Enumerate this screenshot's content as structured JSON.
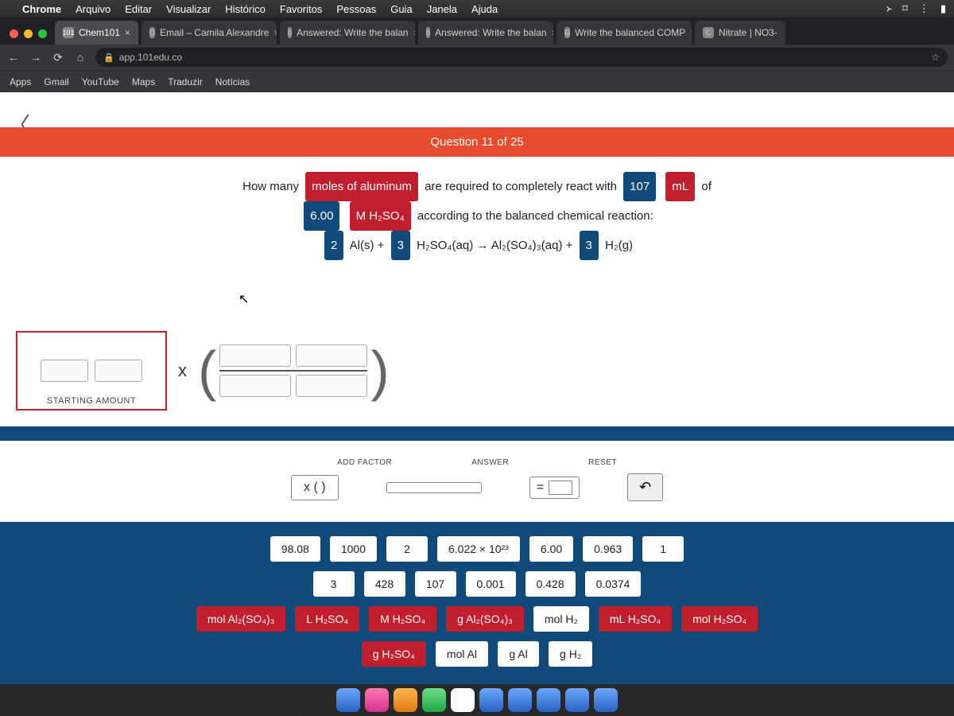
{
  "mac_menu": {
    "app": "Chrome",
    "items": [
      "Arquivo",
      "Editar",
      "Visualizar",
      "Histórico",
      "Favoritos",
      "Pessoas",
      "Guia",
      "Janela",
      "Ajuda"
    ]
  },
  "tabs": [
    {
      "label": "Chem101",
      "fav": "101",
      "active": true
    },
    {
      "label": "Email – Camila Alexandre",
      "fav": "O",
      "active": false
    },
    {
      "label": "Answered: Write the balan",
      "fav": "b",
      "active": false
    },
    {
      "label": "Answered: Write the balan",
      "fav": "b",
      "active": false
    },
    {
      "label": "Write the balanced COMP",
      "fav": "G",
      "active": false
    },
    {
      "label": "Nitrate | NO3-",
      "fav": "C",
      "active": false
    }
  ],
  "address": {
    "url": "app.101edu.co"
  },
  "bookmarks": [
    "Apps",
    "Gmail",
    "YouTube",
    "Maps",
    "Traduzir",
    "Notícias"
  ],
  "banner": "Question 11 of 25",
  "question": {
    "line1_a": "How many",
    "pill1": "moles of aluminum",
    "line1_b": "are required to completely react with",
    "pill2": "107",
    "pill3": "mL",
    "line1_c": "of",
    "pill4": "6.00",
    "pill5": "M H₂SO₄",
    "line2": "according to the balanced chemical reaction:",
    "eq_c1": "2",
    "eq_t1": "Al(s) +",
    "eq_c2": "3",
    "eq_t2": "H₂SO₄(aq) → Al₂(SO₄)₃(aq) +",
    "eq_c3": "3",
    "eq_t3": "H₂(g)"
  },
  "rail": {
    "start_label": "STARTING AMOUNT",
    "times": "x"
  },
  "controls": {
    "add_factor_label": "ADD FACTOR",
    "add_factor_btn": "x (  )",
    "answer_label": "ANSWER",
    "answer_eq": "=",
    "reset_label": "RESET",
    "reset_glyph": "↶"
  },
  "chips_num_row1": [
    "98.08",
    "1000",
    "2",
    "6.022 × 10²³",
    "6.00",
    "0.963",
    "1"
  ],
  "chips_num_row2": [
    "3",
    "428",
    "107",
    "0.001",
    "0.428",
    "0.0374"
  ],
  "chips_unit_row1": [
    {
      "t": "mol Al₂(SO₄)₃",
      "red": true
    },
    {
      "t": "L H₂SO₄",
      "red": true
    },
    {
      "t": "M H₂SO₄",
      "red": true
    },
    {
      "t": "g Al₂(SO₄)₃",
      "red": true
    },
    {
      "t": "mol H₂",
      "red": false
    },
    {
      "t": "mL H₂SO₄",
      "red": true
    },
    {
      "t": "mol H₂SO₄",
      "red": true
    }
  ],
  "chips_unit_row2": [
    {
      "t": "g H₂SO₄",
      "red": true
    },
    {
      "t": "mol Al",
      "red": false
    },
    {
      "t": "g Al",
      "red": false
    },
    {
      "t": "g H₂",
      "red": false
    }
  ]
}
